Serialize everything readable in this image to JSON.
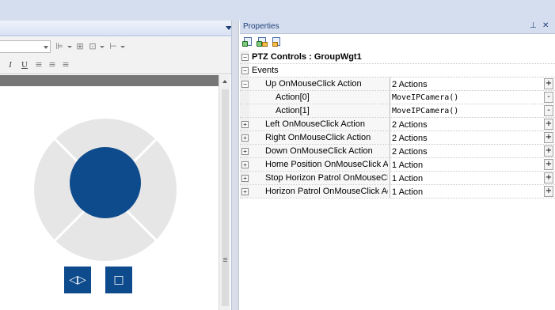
{
  "left_panel": {
    "toolbar_format": {
      "italic": "I",
      "underline": "U",
      "align_icons": [
        "align-left-icon",
        "align-center-icon",
        "align-right-icon"
      ]
    },
    "widget": {
      "left_button_glyph": "◁▷",
      "right_button_glyph": "□",
      "colors": {
        "ring": "#e6e6e6",
        "center": "#0e4b8d",
        "buttons": "#0e4b8d"
      }
    }
  },
  "properties": {
    "panel_title": "Properties",
    "pin_glyph": "⊥",
    "close_glyph": "✕",
    "object_header": "PTZ Controls : GroupWgt1",
    "category": "Events",
    "rows": [
      {
        "name": "Up OnMouseClick Action",
        "value": "2 Actions",
        "expand": "−",
        "edit": "+"
      },
      {
        "name": "Action[0]",
        "value": "MoveIPCamera()",
        "edit": "-"
      },
      {
        "name": "Action[1]",
        "value": "MoveIPCamera()",
        "edit": "-"
      },
      {
        "name": "Left OnMouseClick Action",
        "value": "2 Actions",
        "expand": "+",
        "edit": "+"
      },
      {
        "name": "Right OnMouseClick Action",
        "value": "2 Actions",
        "expand": "+",
        "edit": "+"
      },
      {
        "name": "Down OnMouseClick Action",
        "value": "2 Actions",
        "expand": "+",
        "edit": "+"
      },
      {
        "name": "Home Position OnMouseClick Act",
        "value": "1 Action",
        "expand": "+",
        "edit": "+"
      },
      {
        "name": "Stop Horizon Patrol OnMouseClic",
        "value": "1 Action",
        "expand": "+",
        "edit": "+"
      },
      {
        "name": "Horizon Patrol OnMouseClick Acti",
        "value": "1 Action",
        "expand": "+",
        "edit": "+"
      }
    ]
  }
}
